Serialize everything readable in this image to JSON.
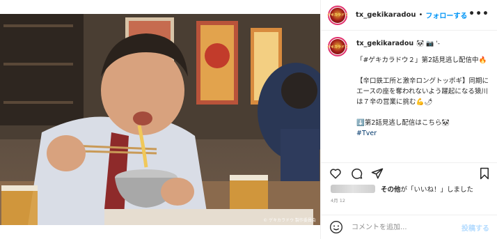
{
  "post": {
    "username": "tx_gekikaradou",
    "photo_credit": "© ゲキカラドウ 製作委員会",
    "avatar_text": "ゲキカラドウ"
  },
  "header": {
    "separator": "•",
    "follow_label": "フォローする",
    "more_label": "•••"
  },
  "caption": {
    "emoji": "🐼 📷 '-",
    "lines": [
      "「#ゲキカラドウ２」第2話見逃し配信中🔥",
      "【辛口鉄工所と激辛ロングトッポギ】同期にエースの座を奪われないよう躍起になる猿川は７辛の営業に挑む💪🌶",
      "⬇️第2話見逃し配信はこちら🐼"
    ],
    "hashtag": "#Tver"
  },
  "actions": {
    "like_icon": "heart-icon",
    "comment_icon": "comment-icon",
    "share_icon": "share-icon",
    "save_icon": "bookmark-icon"
  },
  "likes": {
    "text_bold": "その他",
    "text_rest": "が「いいね！」しました"
  },
  "date": "4月 12",
  "comment": {
    "placeholder": "コメントを追加...",
    "post_label": "投稿する"
  },
  "colors": {
    "link_blue": "#0095f6",
    "post_disabled": "#b3dbff",
    "avatar_ring": "#e1306c"
  }
}
